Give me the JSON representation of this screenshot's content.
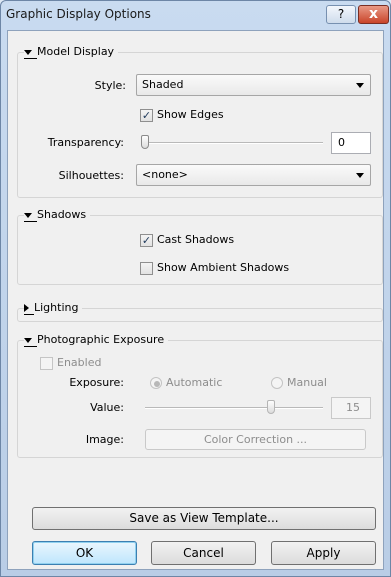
{
  "window": {
    "title": "Graphic Display Options",
    "help_glyph": "?",
    "close_glyph": "x"
  },
  "model_display": {
    "header": "Model Display",
    "style_label": "Style:",
    "style_value": "Shaded",
    "show_edges_label": "Show Edges",
    "show_edges_checked": true,
    "transparency_label": "Transparency:",
    "transparency_value": "0",
    "silhouettes_label": "Silhouettes:",
    "silhouettes_value": "<none>"
  },
  "shadows": {
    "header": "Shadows",
    "cast_shadows_label": "Cast Shadows",
    "cast_shadows_checked": true,
    "ambient_shadows_label": "Show Ambient Shadows",
    "ambient_shadows_checked": false
  },
  "lighting": {
    "header": "Lighting"
  },
  "photographic_exposure": {
    "header": "Photographic Exposure",
    "enabled_label": "Enabled",
    "enabled_checked": false,
    "exposure_label": "Exposure:",
    "automatic_label": "Automatic",
    "manual_label": "Manual",
    "exposure_selected": "Automatic",
    "value_label": "Value:",
    "value": "15",
    "image_label": "Image:",
    "color_correction_label": "Color Correction ..."
  },
  "footer": {
    "save_template_label": "Save as View Template...",
    "ok_label": "OK",
    "cancel_label": "Cancel",
    "apply_label": "Apply"
  },
  "icons": {
    "checkmark": "✓"
  },
  "colors": {
    "title_bar": "#c9dbf0",
    "close_button": "#c9452a",
    "dialog_bg": "#f0f0f0",
    "default_button": "#bee6fd"
  }
}
